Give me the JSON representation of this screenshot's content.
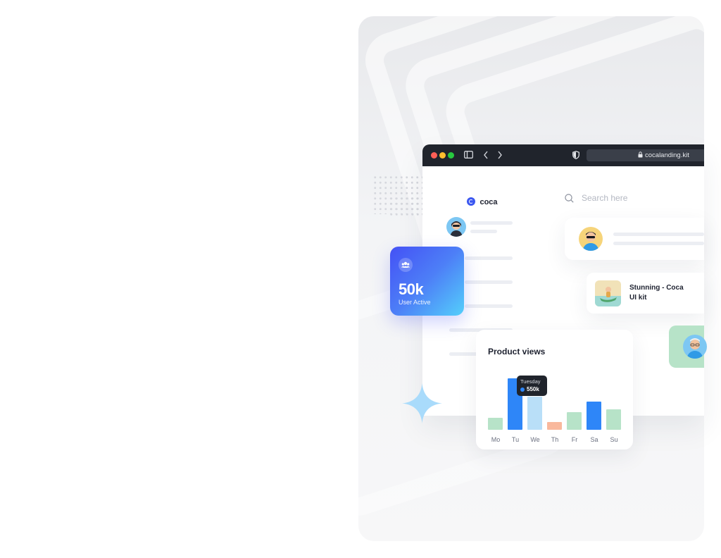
{
  "browser": {
    "url": "cocalanding.kit",
    "traffic_light_colors": [
      "#ff5f56",
      "#ffbd2e",
      "#27c93f"
    ]
  },
  "app": {
    "brand": "coca",
    "search_placeholder": "Search here"
  },
  "stat_card": {
    "value": "50k",
    "label": "User Active",
    "icon": "users-icon",
    "gradient": [
      "#4451f5",
      "#54cffb"
    ]
  },
  "product_card": {
    "title_line1": "Stunning - Coca",
    "title_line2": "UI kit"
  },
  "chart": {
    "title": "Product views",
    "tooltip_day": "Tuesday",
    "tooltip_value": "550k"
  },
  "chart_data": {
    "type": "bar",
    "title": "Product views",
    "categories": [
      "Mo",
      "Tu",
      "We",
      "Th",
      "Fr",
      "Sa",
      "Su"
    ],
    "values": [
      13,
      55,
      35,
      8,
      19,
      30,
      22
    ],
    "colors": [
      "#b7e3c8",
      "#2e86f8",
      "#b9dff8",
      "#f9b89c",
      "#b7e3c8",
      "#2e86f8",
      "#b7e3c8"
    ],
    "ylim": [
      0,
      60
    ],
    "grid": false,
    "tooltip": {
      "category": "Tuesday",
      "value": "550k"
    }
  }
}
